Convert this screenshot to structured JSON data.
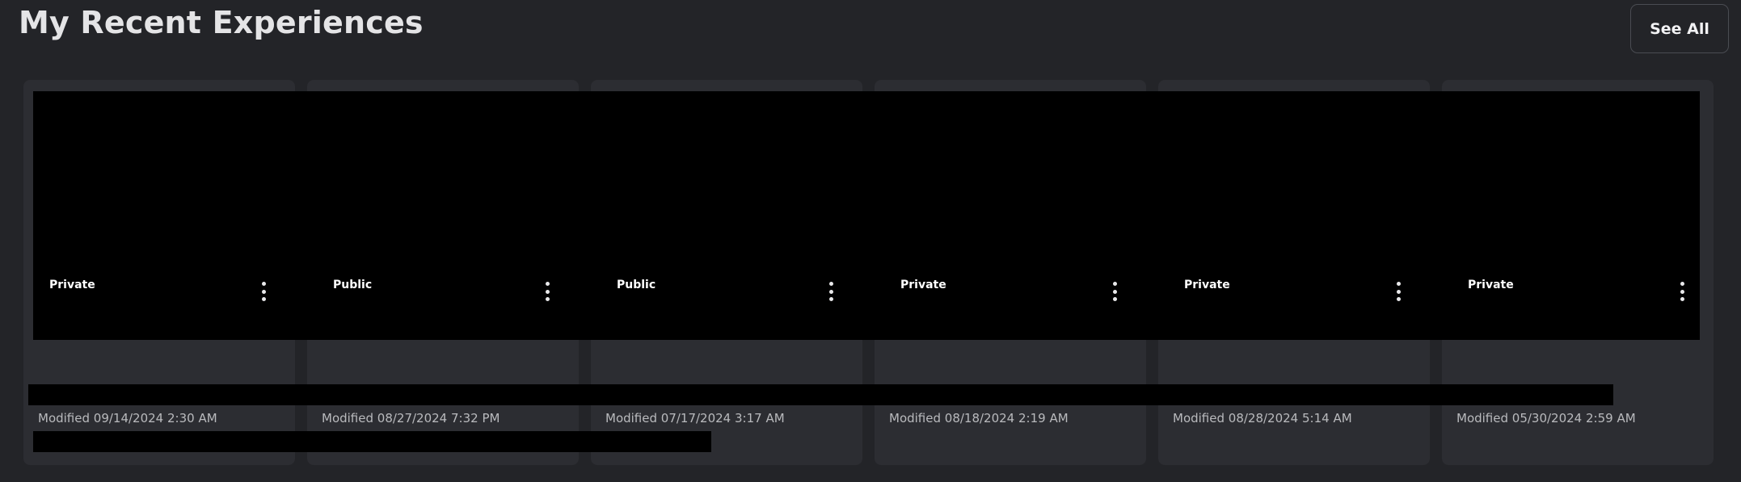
{
  "header": {
    "title": "My Recent Experiences",
    "see_all_label": "See All"
  },
  "cards": [
    {
      "visibility": "Private",
      "modified": "Modified 09/14/2024 2:30 AM"
    },
    {
      "visibility": "Public",
      "modified": "Modified 08/27/2024 7:32 PM"
    },
    {
      "visibility": "Public",
      "modified": "Modified 07/17/2024 3:17 AM"
    },
    {
      "visibility": "Private",
      "modified": "Modified 08/18/2024 2:19 AM"
    },
    {
      "visibility": "Private",
      "modified": "Modified 08/28/2024 5:14 AM"
    },
    {
      "visibility": "Private",
      "modified": "Modified 05/30/2024 2:59 AM"
    }
  ],
  "icons": {
    "more_options": "vertical-ellipsis-icon"
  },
  "colors": {
    "background": "#232428",
    "card": "#2c2d32",
    "badge": "#000000",
    "redaction": "#000000"
  }
}
